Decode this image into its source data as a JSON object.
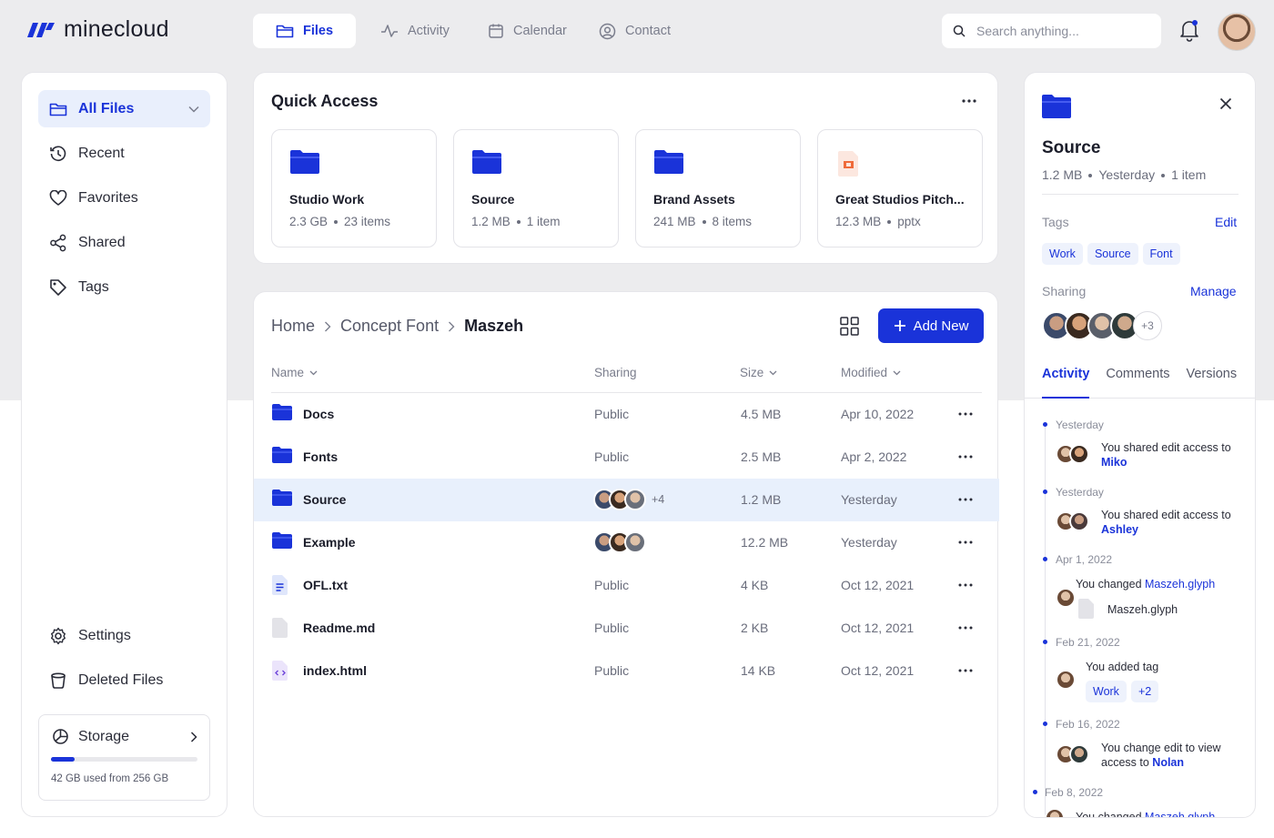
{
  "brand": {
    "name": "minecloud"
  },
  "nav": {
    "tabs": [
      {
        "label": "Files",
        "icon": "folder-icon",
        "active": true
      },
      {
        "label": "Activity",
        "icon": "activity-icon"
      },
      {
        "label": "Calendar",
        "icon": "calendar-icon"
      },
      {
        "label": "Contact",
        "icon": "contact-icon"
      }
    ]
  },
  "search": {
    "placeholder": "Search anything..."
  },
  "sidebar": {
    "items": [
      {
        "label": "All Files",
        "icon": "folder-icon",
        "active": true
      },
      {
        "label": "Recent",
        "icon": "clock-icon"
      },
      {
        "label": "Favorites",
        "icon": "heart-icon"
      },
      {
        "label": "Shared",
        "icon": "share-icon"
      },
      {
        "label": "Tags",
        "icon": "tag-icon"
      }
    ],
    "bottom": [
      {
        "label": "Settings",
        "icon": "gear-icon"
      },
      {
        "label": "Deleted Files",
        "icon": "trash-icon"
      }
    ],
    "storage": {
      "label": "Storage",
      "used_text": "42 GB used from 256 GB",
      "fraction": 0.164
    }
  },
  "quick_access": {
    "title": "Quick Access",
    "cards": [
      {
        "name": "Studio Work",
        "size": "2.3 GB",
        "count": "23 items",
        "type": "folder"
      },
      {
        "name": "Source",
        "size": "1.2 MB",
        "count": "1 item",
        "type": "folder"
      },
      {
        "name": "Brand Assets",
        "size": "241 MB",
        "count": "8 items",
        "type": "folder"
      },
      {
        "name": "Great Studios Pitch...",
        "size": "12.3 MB",
        "count": "pptx",
        "type": "pptx"
      }
    ]
  },
  "browser": {
    "breadcrumb": [
      "Home",
      "Concept Font",
      "Maszeh"
    ],
    "add_label": "Add New",
    "columns": {
      "name": "Name",
      "sharing": "Sharing",
      "size": "Size",
      "modified": "Modified"
    },
    "rows": [
      {
        "name": "Docs",
        "type": "folder",
        "sharing": "Public",
        "size": "4.5 MB",
        "modified": "Apr 10, 2022"
      },
      {
        "name": "Fonts",
        "type": "folder",
        "sharing": "Public",
        "size": "2.5 MB",
        "modified": "Apr 2, 2022"
      },
      {
        "name": "Source",
        "type": "folder",
        "sharing": "avatars",
        "extra": "+4",
        "size": "1.2 MB",
        "modified": "Yesterday",
        "selected": true
      },
      {
        "name": "Example",
        "type": "folder",
        "sharing": "avatars",
        "extra": "",
        "size": "12.2 MB",
        "modified": "Yesterday"
      },
      {
        "name": "OFL.txt",
        "type": "doc",
        "sharing": "Public",
        "size": "4 KB",
        "modified": "Oct 12, 2021"
      },
      {
        "name": "Readme.md",
        "type": "file",
        "sharing": "Public",
        "size": "2 KB",
        "modified": "Oct 12, 2021"
      },
      {
        "name": "index.html",
        "type": "code",
        "sharing": "Public",
        "size": "14 KB",
        "modified": "Oct 12, 2021"
      }
    ]
  },
  "detail": {
    "title": "Source",
    "size": "1.2 MB",
    "when": "Yesterday",
    "count": "1 item",
    "tags_label": "Tags",
    "tags_edit": "Edit",
    "tags": [
      "Work",
      "Source",
      "Font"
    ],
    "sharing_label": "Sharing",
    "sharing_manage": "Manage",
    "sharing_more": "+3",
    "tabs": [
      "Activity",
      "Comments",
      "Versions"
    ],
    "activity": [
      {
        "date": "Yesterday",
        "text": "You shared edit access to",
        "target": "Miko"
      },
      {
        "date": "Yesterday",
        "text": "You shared edit access to",
        "target": "Ashley"
      },
      {
        "date": "Apr 1, 2022",
        "text": "You changed",
        "target": "Maszeh.glyph",
        "file": "Maszeh.glyph"
      },
      {
        "date": "Feb 21, 2022",
        "text": "You added tag",
        "tags": [
          "Work",
          "+2"
        ]
      },
      {
        "date": "Feb 16, 2022",
        "text": "You change edit to view access to",
        "target": "Nolan"
      },
      {
        "date": "Feb 8, 2022",
        "text": "You changed",
        "target": "Maszeh.glyph"
      }
    ]
  },
  "colors": {
    "accent": "#1a33d9",
    "selected_row": "#e8f0fc",
    "background_top": "#ececee"
  }
}
